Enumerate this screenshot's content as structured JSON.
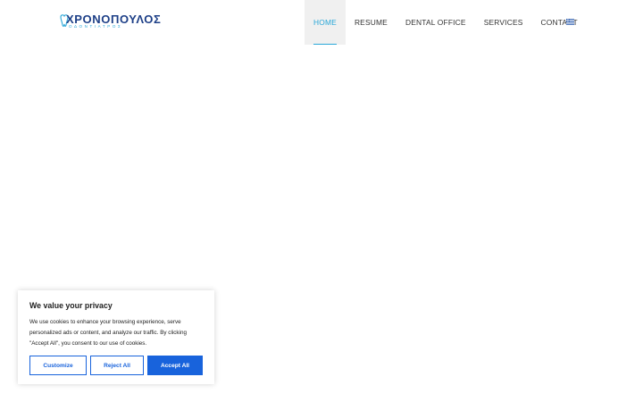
{
  "header": {
    "logo_text": "ΧΡΟΝΟΠΟΥΛΟΣ",
    "logo_subtext": "ΟΔΟΝΤΙΑΤΡΟΣ",
    "nav": [
      {
        "label": "HOME",
        "active": true
      },
      {
        "label": "RESUME",
        "active": false
      },
      {
        "label": "DENTAL OFFICE",
        "active": false
      },
      {
        "label": "SERVICES",
        "active": false
      },
      {
        "label": "CONTACT",
        "active": false
      }
    ],
    "language_icon": "greek-flag-icon"
  },
  "colors": {
    "accent": "#2aa7d8",
    "brand": "#1d3f87",
    "button_blue": "#1863dc"
  },
  "cookie_banner": {
    "title": "We value your privacy",
    "text": "We use cookies to enhance your browsing experience, serve personalized ads or content, and analyze our traffic. By clicking \"Accept All\", you consent to our use of cookies.",
    "buttons": {
      "customize": "Customize",
      "reject": "Reject All",
      "accept": "Accept All"
    }
  }
}
